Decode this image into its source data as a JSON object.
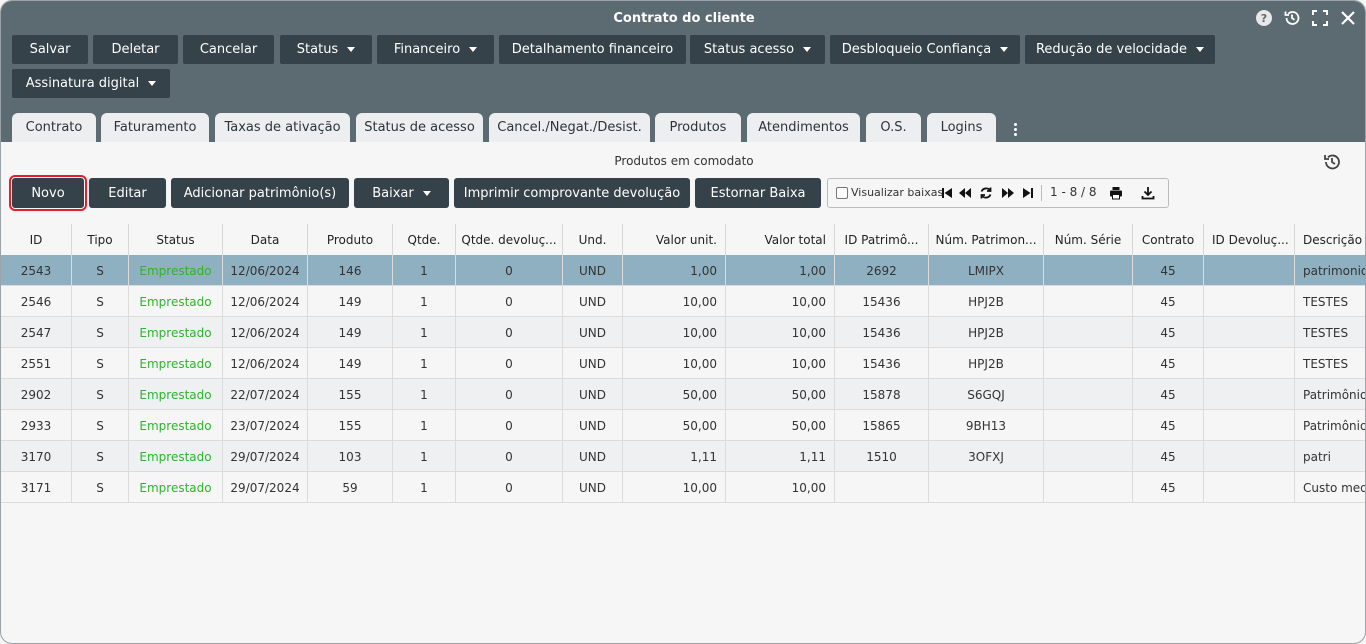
{
  "window": {
    "title": "Contrato do cliente"
  },
  "toolbar": [
    {
      "label": "Salvar",
      "dropdown": false
    },
    {
      "label": "Deletar",
      "dropdown": false
    },
    {
      "label": "Cancelar",
      "dropdown": false
    },
    {
      "label": "Status",
      "dropdown": true
    },
    {
      "label": "Financeiro",
      "dropdown": true
    },
    {
      "label": "Detalhamento financeiro",
      "dropdown": false
    },
    {
      "label": "Status acesso",
      "dropdown": true
    },
    {
      "label": "Desbloqueio Confiança",
      "dropdown": true
    },
    {
      "label": "Redução de velocidade",
      "dropdown": true
    },
    {
      "label": "Assinatura digital",
      "dropdown": true
    }
  ],
  "tabs": [
    "Contrato",
    "Faturamento",
    "Taxas de ativação",
    "Status de acesso",
    "Cancel./Negat./Desist.",
    "Produtos",
    "Atendimentos",
    "O.S.",
    "Logins"
  ],
  "section": {
    "title": "Produtos em comodato"
  },
  "actions": [
    {
      "label": "Novo",
      "dropdown": false
    },
    {
      "label": "Editar",
      "dropdown": false
    },
    {
      "label": "Adicionar patrimônio(s)",
      "dropdown": false
    },
    {
      "label": "Baixar",
      "dropdown": true
    },
    {
      "label": "Imprimir comprovante devolução",
      "dropdown": false
    },
    {
      "label": "Estornar Baixa",
      "dropdown": false
    }
  ],
  "pager": {
    "checkbox_label": "Visualizar baixas",
    "count": "1 - 8 / 8"
  },
  "table": {
    "columns": [
      "ID",
      "Tipo",
      "Status",
      "Data",
      "Produto",
      "Qtde.",
      "Qtde. devoluç...",
      "Und.",
      "Valor unit.",
      "Valor total",
      "ID Patrimô...",
      "Núm. Patrimon...",
      "Núm. Série",
      "Contrato",
      "ID Devoluç...",
      "Descrição p"
    ],
    "rows": [
      [
        "2543",
        "S",
        "Emprestado",
        "12/06/2024",
        "146",
        "1",
        "0",
        "UND",
        "1,00",
        "1,00",
        "2692",
        "LMIPX",
        "",
        "45",
        "",
        "patrimonio"
      ],
      [
        "2546",
        "S",
        "Emprestado",
        "12/06/2024",
        "149",
        "1",
        "0",
        "UND",
        "10,00",
        "10,00",
        "15436",
        "HPJ2B",
        "",
        "45",
        "",
        "TESTES"
      ],
      [
        "2547",
        "S",
        "Emprestado",
        "12/06/2024",
        "149",
        "1",
        "0",
        "UND",
        "10,00",
        "10,00",
        "15436",
        "HPJ2B",
        "",
        "45",
        "",
        "TESTES"
      ],
      [
        "2551",
        "S",
        "Emprestado",
        "12/06/2024",
        "149",
        "1",
        "0",
        "UND",
        "10,00",
        "10,00",
        "15436",
        "HPJ2B",
        "",
        "45",
        "",
        "TESTES"
      ],
      [
        "2902",
        "S",
        "Emprestado",
        "22/07/2024",
        "155",
        "1",
        "0",
        "UND",
        "50,00",
        "50,00",
        "15878",
        "S6GQJ",
        "",
        "45",
        "",
        "Patrimônio"
      ],
      [
        "2933",
        "S",
        "Emprestado",
        "23/07/2024",
        "155",
        "1",
        "0",
        "UND",
        "50,00",
        "50,00",
        "15865",
        "9BH13",
        "",
        "45",
        "",
        "Patrimônio"
      ],
      [
        "3170",
        "S",
        "Emprestado",
        "29/07/2024",
        "103",
        "1",
        "0",
        "UND",
        "1,11",
        "1,11",
        "1510",
        "3OFXJ",
        "",
        "45",
        "",
        "patri"
      ],
      [
        "3171",
        "S",
        "Emprestado",
        "29/07/2024",
        "59",
        "1",
        "0",
        "UND",
        "10,00",
        "10,00",
        "",
        "",
        "",
        "45",
        "",
        "Custo medi"
      ]
    ],
    "selected_row": 0
  },
  "colors": {
    "header_bg": "#5c6a72",
    "button_bg": "#35424a",
    "selected_row": "#8fb0c0",
    "status_green": "#2db52d",
    "highlight_outline": "#e0202a"
  }
}
